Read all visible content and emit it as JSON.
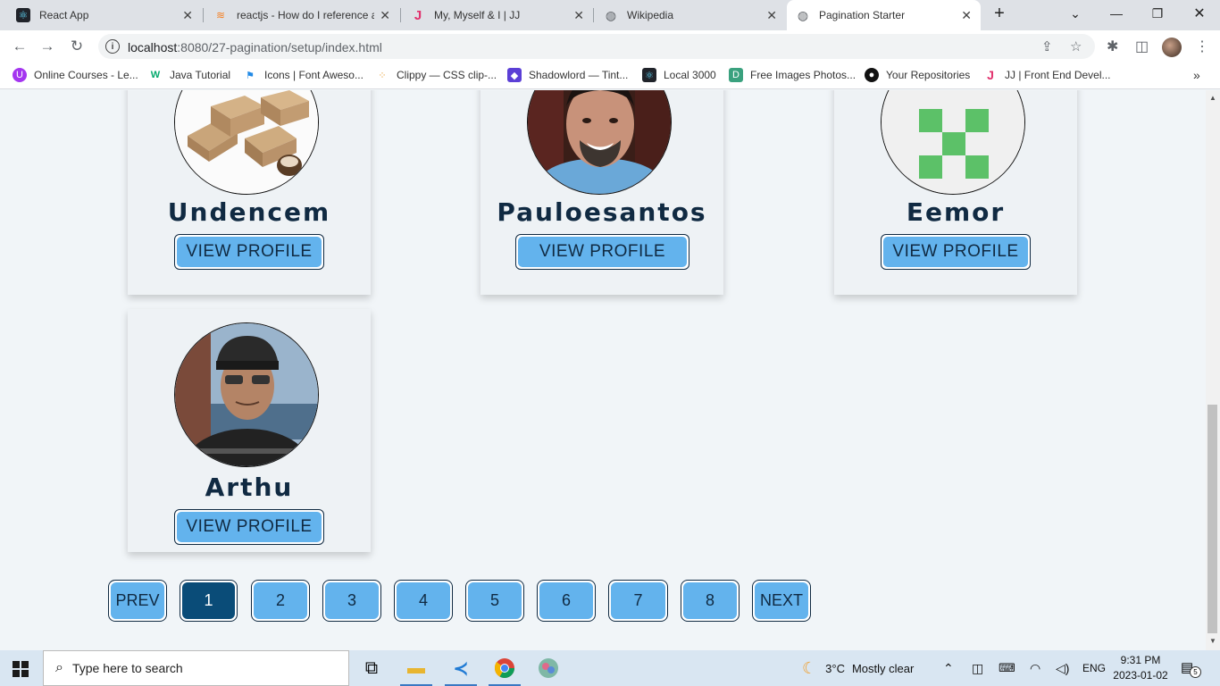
{
  "browser": {
    "tabs": [
      {
        "title": "React App",
        "icon": "react-icon",
        "active": false
      },
      {
        "title": "reactjs - How do I reference a",
        "icon": "stackoverflow-icon",
        "active": false
      },
      {
        "title": "My, Myself & I | JJ",
        "icon": "jj-icon",
        "active": false
      },
      {
        "title": "Wikipedia",
        "icon": "globe-icon",
        "active": false
      },
      {
        "title": "Pagination Starter",
        "icon": "globe-icon",
        "active": true
      }
    ],
    "new_tab": "+",
    "url_host": "localhost",
    "url_path": ":8080/27-pagination/setup/index.html",
    "bookmarks": [
      {
        "label": "Online Courses - Le...",
        "icon": "udemy-icon",
        "color": "#a435f0"
      },
      {
        "label": "Java Tutorial",
        "icon": "w3-icon",
        "color": "#04aa6d"
      },
      {
        "label": "Icons | Font Aweso...",
        "icon": "flag-icon",
        "color": "#228ae6"
      },
      {
        "label": "Clippy — CSS clip-...",
        "icon": "dots-icon",
        "color": "#e8a33c"
      },
      {
        "label": "Shadowlord — Tint...",
        "icon": "shadowlord-icon",
        "color": "#5b3fd6"
      },
      {
        "label": "Local 3000",
        "icon": "react-icon",
        "color": "#20232a"
      },
      {
        "label": "Free Images Photos...",
        "icon": "d-icon",
        "color": "#3aa17e"
      },
      {
        "label": "Your Repositories",
        "icon": "github-icon",
        "color": "#111111"
      },
      {
        "label": "JJ | Front End Devel...",
        "icon": "jj-icon",
        "color": "#e1306c"
      }
    ]
  },
  "followers": [
    {
      "login": "Undencem",
      "button": "VIEW PROFILE",
      "avatar": "boxes"
    },
    {
      "login": "Pauloesantos",
      "button": "VIEW PROFILE",
      "avatar": "man"
    },
    {
      "login": "Eemor",
      "button": "VIEW PROFILE",
      "avatar": "identicon"
    },
    {
      "login": "Arthu",
      "button": "VIEW PROFILE",
      "avatar": "cap-man"
    }
  ],
  "pagination": {
    "prev": "PREV",
    "next": "NEXT",
    "pages": [
      "1",
      "2",
      "3",
      "4",
      "5",
      "6",
      "7",
      "8"
    ],
    "active_page": "1"
  },
  "taskbar": {
    "search_placeholder": "Type here to search",
    "weather_temp": "3°C",
    "weather_text": "Mostly clear",
    "lang": "ENG",
    "time": "9:31 PM",
    "date": "2023-01-02",
    "notifications": "5"
  },
  "colors": {
    "accent": "#63b3ed",
    "active": "#0a4c78",
    "text_dark": "#102a42",
    "identicon": "#5cc168"
  }
}
